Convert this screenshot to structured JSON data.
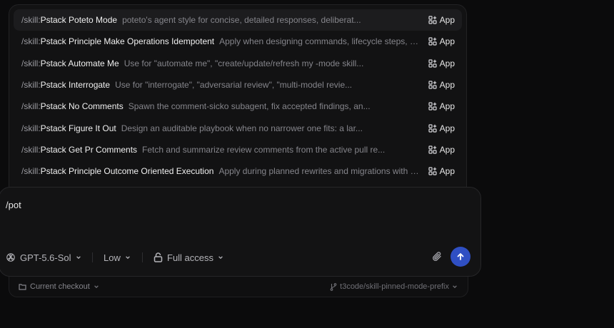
{
  "menu": {
    "items": [
      {
        "prefix": "/skill:",
        "name": "Pstack Poteto Mode",
        "desc": "poteto's agent style for concise, detailed responses, deliberat...",
        "badge": "App"
      },
      {
        "prefix": "/skill:",
        "name": "Pstack Principle Make Operations Idempotent",
        "desc": "Apply when designing commands, lifecycle steps, or pr...",
        "badge": "App"
      },
      {
        "prefix": "/skill:",
        "name": "Pstack Automate Me",
        "desc": "Use for \"automate me\", \"create/update/refresh my -mode skill...",
        "badge": "App"
      },
      {
        "prefix": "/skill:",
        "name": "Pstack Interrogate",
        "desc": "Use for \"interrogate\", \"adversarial review\", \"multi-model revie...",
        "badge": "App"
      },
      {
        "prefix": "/skill:",
        "name": "Pstack No Comments",
        "desc": "Spawn the comment-sicko subagent, fix accepted findings, an...",
        "badge": "App"
      },
      {
        "prefix": "/skill:",
        "name": "Pstack Figure It Out",
        "desc": "Design an auditable playbook when no narrower one fits: a lar...",
        "badge": "App"
      },
      {
        "prefix": "/skill:",
        "name": "Pstack Get Pr Comments",
        "desc": "Fetch and summarize review comments from the active pull re...",
        "badge": "App"
      },
      {
        "prefix": "/skill:",
        "name": "Pstack Principle Outcome Oriented Execution",
        "desc": "Apply during planned rewrites and migrations with expli...",
        "badge": "App"
      }
    ]
  },
  "composer": {
    "input_text": "/pot",
    "model": "GPT-5.6-Sol",
    "effort": "Low",
    "access": "Full access"
  },
  "footer": {
    "checkout": "Current checkout",
    "branch": "t3code/skill-pinned-mode-prefix"
  },
  "colors": {
    "send_button": "#2f4fc3",
    "background": "#0b0b0c",
    "panel": "#121213"
  }
}
